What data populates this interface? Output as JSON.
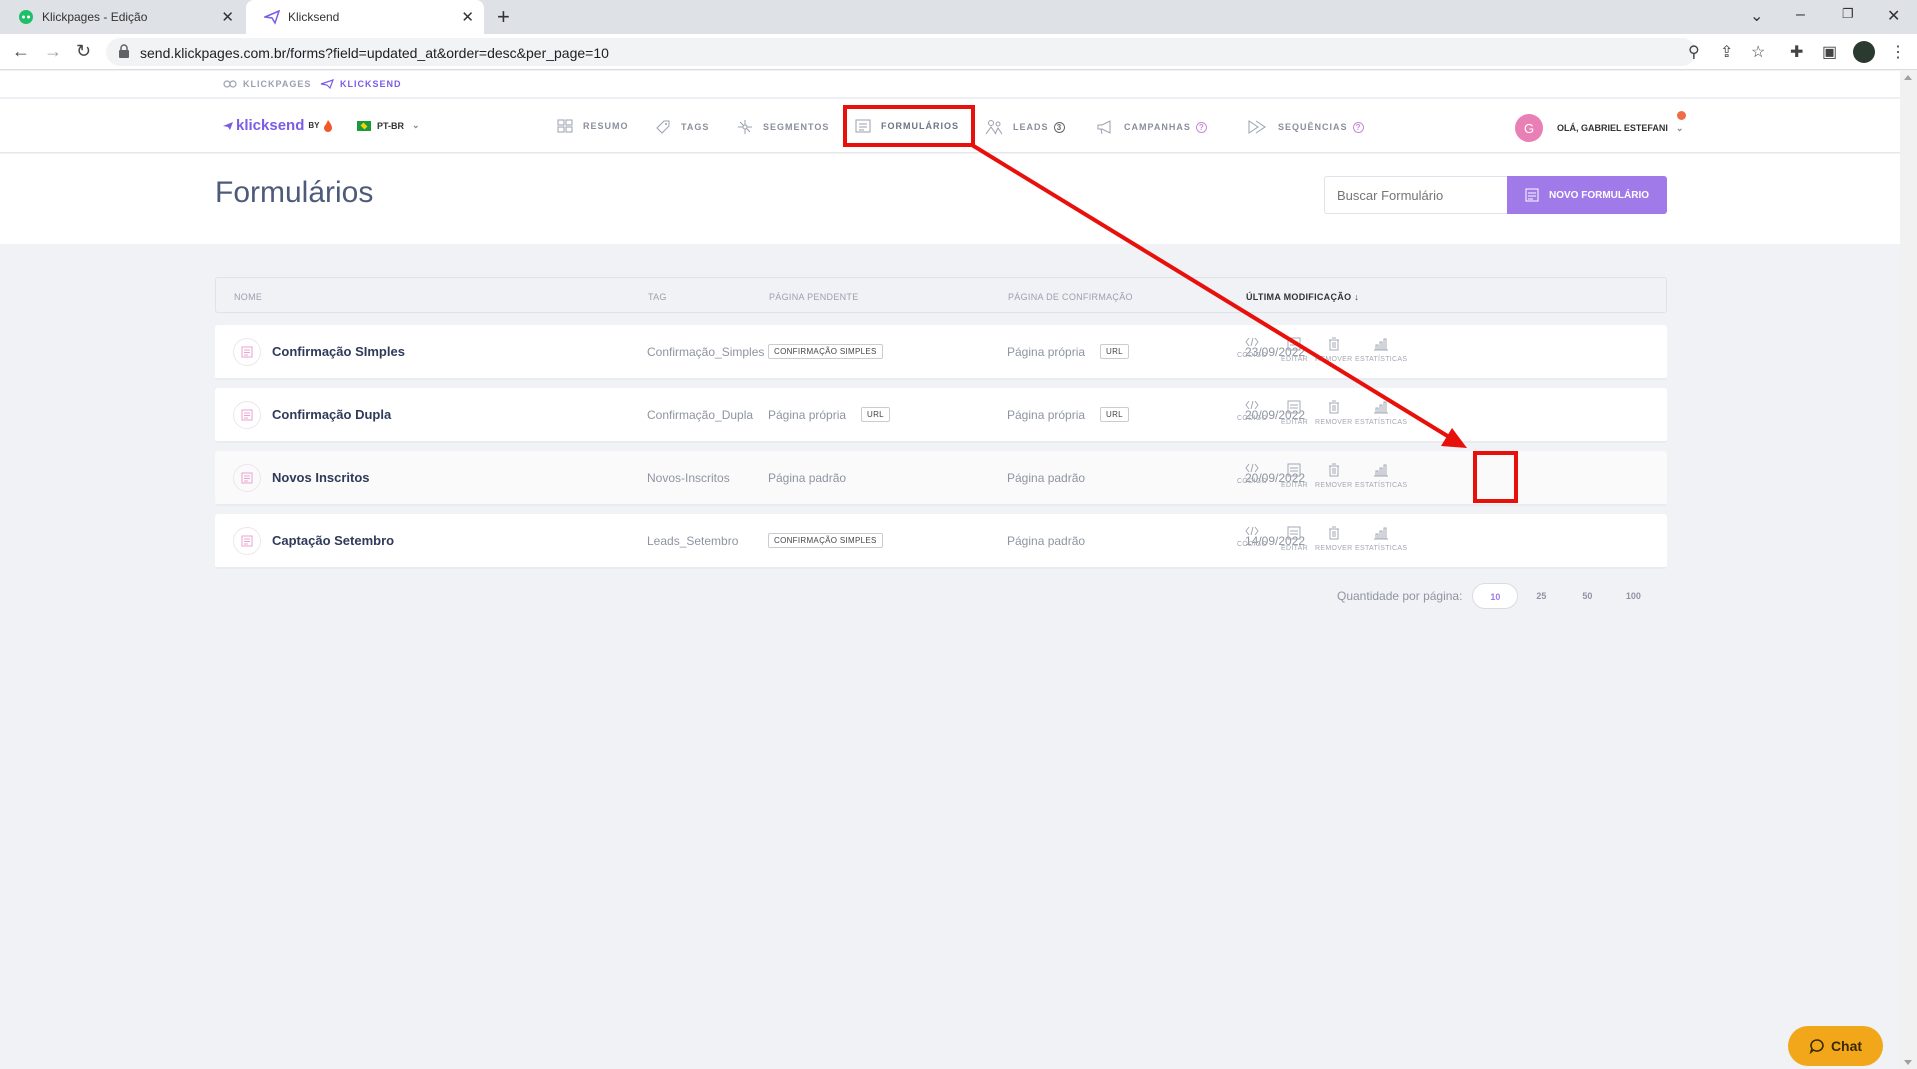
{
  "browser": {
    "tabs": [
      {
        "title": "Klickpages - Edição"
      },
      {
        "title": "Klicksend"
      }
    ],
    "url": "send.klickpages.com.br/forms?field=updated_at&order=desc&per_page=10"
  },
  "topstrip": {
    "products": [
      "KLICKPAGES",
      "KLICKSEND"
    ]
  },
  "nav": {
    "logo_text": "klicksend",
    "logo_by": "BY",
    "language": "PT-BR",
    "items": [
      {
        "label": "RESUMO",
        "icon": "grid-icon"
      },
      {
        "label": "TAGS",
        "icon": "tag-icon"
      },
      {
        "label": "SEGMENTOS",
        "icon": "segments-icon"
      },
      {
        "label": "FORMULÁRIOS",
        "icon": "form-icon"
      },
      {
        "label": "LEADS",
        "icon": "people-icon",
        "badge": "3"
      },
      {
        "label": "CAMPANHAS",
        "icon": "megaphone-icon",
        "badge": "?"
      },
      {
        "label": "SEQUÊNCIAS",
        "icon": "sequence-icon",
        "badge": "?"
      }
    ],
    "user": {
      "initial": "G",
      "greeting": "OLÁ, GABRIEL ESTEFANI"
    }
  },
  "page": {
    "title": "Formulários",
    "search_placeholder": "Buscar Formulário",
    "new_button": "NOVO FORMULÁRIO"
  },
  "table": {
    "headers": [
      "NOME",
      "TAG",
      "PÁGINA PENDENTE",
      "PÁGINA DE CONFIRMAÇÃO",
      "ÚLTIMA MODIFICAÇÃO"
    ],
    "sort_arrow": "↓",
    "actions": [
      "CÓDIGO",
      "EDITAR",
      "REMOVER",
      "ESTATÍSTICAS"
    ],
    "rows": [
      {
        "name": "Confirmação SImples",
        "tag": "Confirmação_Simples",
        "pending": "",
        "pending_badge": "CONFIRMAÇÃO SIMPLES",
        "confirmation": "Página própria",
        "confirmation_badge": "URL",
        "date": "23/09/2022"
      },
      {
        "name": "Confirmação Dupla",
        "tag": "Confirmação_Dupla",
        "pending": "Página própria",
        "pending_badge": "URL",
        "confirmation": "Página própria",
        "confirmation_badge": "URL",
        "date": "20/09/2022"
      },
      {
        "name": "Novos Inscritos",
        "tag": "Novos-Inscritos",
        "pending": "Página padrão",
        "pending_badge": "",
        "confirmation": "Página padrão",
        "confirmation_badge": "",
        "date": "20/09/2022"
      },
      {
        "name": "Captação Setembro",
        "tag": "Leads_Setembro",
        "pending": "",
        "pending_badge": "CONFIRMAÇÃO SIMPLES",
        "confirmation": "Página padrão",
        "confirmation_badge": "",
        "date": "14/09/2022"
      }
    ]
  },
  "pagination": {
    "label": "Quantidade por página:",
    "options": [
      "10",
      "25",
      "50",
      "100"
    ],
    "selected": "10"
  },
  "chat": {
    "label": "Chat"
  },
  "colors": {
    "accent": "#9f7ae8",
    "highlight": "#e8100a",
    "chat": "#f2a71b"
  }
}
